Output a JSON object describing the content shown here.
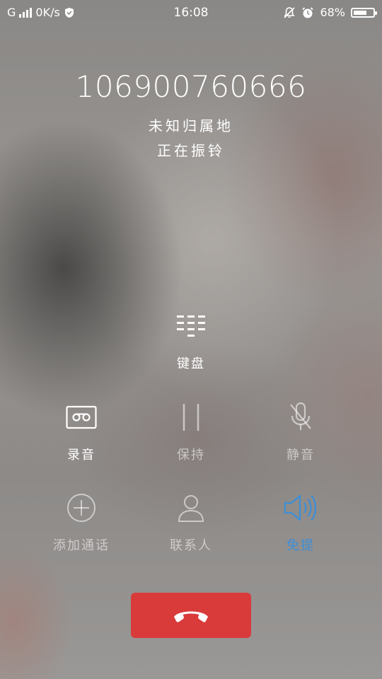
{
  "status_bar": {
    "network_type": "G",
    "speed": "0K/s",
    "time": "16:08",
    "battery": "68%",
    "battery_level": 0.68,
    "icons": [
      "signal-icon",
      "shield-icon",
      "silent-bell-icon",
      "alarm-clock-icon",
      "battery-icon"
    ]
  },
  "call": {
    "number": "106900760666",
    "location": "未知归属地",
    "status": "正在振铃"
  },
  "controls": {
    "keypad": "键盘",
    "record": "录音",
    "hold": "保持",
    "mute": "静音",
    "add_call": "添加通话",
    "contacts": "联系人",
    "speaker": "免提"
  },
  "colors": {
    "end_call": "#d93a3a",
    "active_blue": "#3d8fd8"
  }
}
